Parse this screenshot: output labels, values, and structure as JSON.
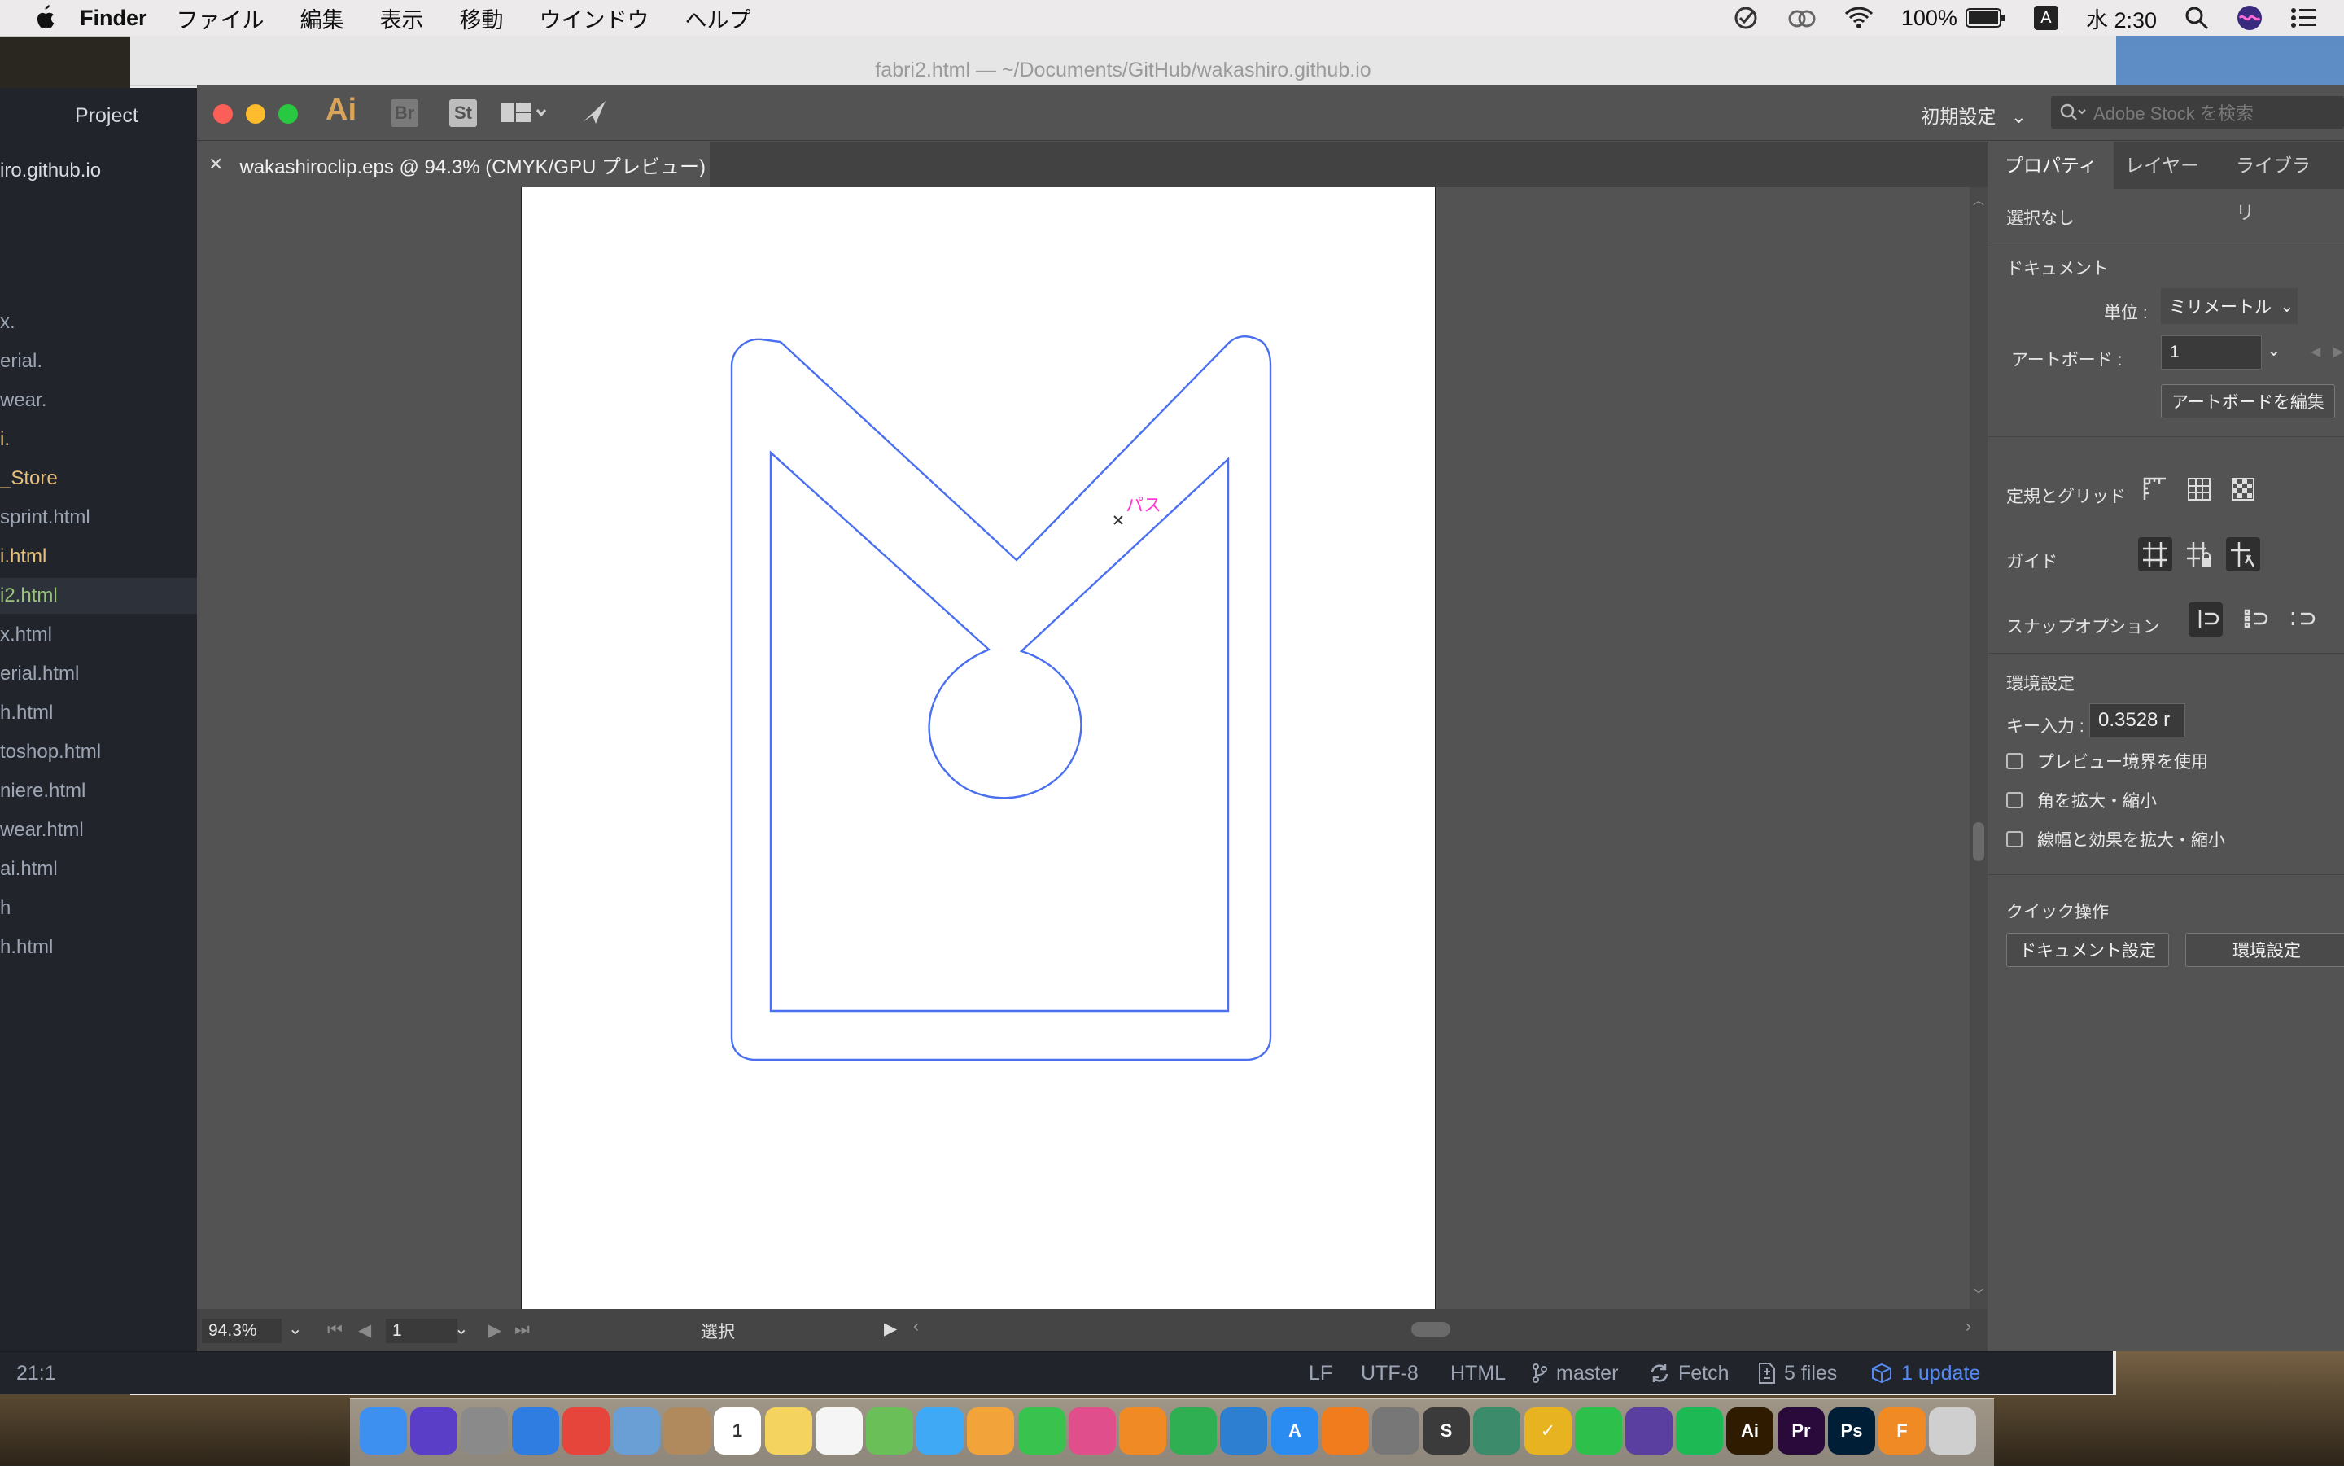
{
  "menubar": {
    "app_name": "Finder",
    "items": [
      "ファイル",
      "編集",
      "表示",
      "移動",
      "ウインドウ",
      "ヘルプ"
    ],
    "battery": "100%",
    "input_mode": "A",
    "clock": "水 2:30"
  },
  "background_window": {
    "title": "fabri2.html — ~/Documents/GitHub/wakashiro.github.io"
  },
  "atom_sidebar": {
    "header": "Project",
    "root": "iro.github.io",
    "items": [
      {
        "label": "x.",
        "color": "#9da5b4"
      },
      {
        "label": "erial.",
        "color": "#9da5b4"
      },
      {
        "label": "wear.",
        "color": "#9da5b4"
      },
      {
        "label": "i.",
        "color": "#e5c07b"
      },
      {
        "label": "_Store",
        "color": "#e5c07b"
      },
      {
        "label": "sprint.html",
        "color": "#9da5b4"
      },
      {
        "label": "i.html",
        "color": "#e5c07b"
      },
      {
        "label": "i2.html",
        "color": "#98c379"
      },
      {
        "label": "x.html",
        "color": "#9da5b4"
      },
      {
        "label": "erial.html",
        "color": "#9da5b4"
      },
      {
        "label": "h.html",
        "color": "#9da5b4"
      },
      {
        "label": "toshop.html",
        "color": "#9da5b4"
      },
      {
        "label": "niere.html",
        "color": "#9da5b4"
      },
      {
        "label": "wear.html",
        "color": "#9da5b4"
      },
      {
        "label": "ai.html",
        "color": "#9da5b4"
      },
      {
        "label": "h",
        "color": "#9da5b4"
      },
      {
        "label": "h.html",
        "color": "#9da5b4"
      }
    ]
  },
  "illustrator": {
    "logo": "Ai",
    "bridge": "Br",
    "stock": "St",
    "workspace": "初期設定",
    "stock_search_placeholder": "Adobe Stock を検索",
    "doc_tab": "wakashiroclip.eps @ 94.3% (CMYK/GPU プレビュー)",
    "path_label": "パス",
    "status": {
      "zoom": "94.3%",
      "artboard": "1",
      "tool": "選択"
    },
    "properties": {
      "tabs": [
        "プロパティ",
        "レイヤー",
        "ライブラリ"
      ],
      "selection": "選択なし",
      "document_heading": "ドキュメント",
      "unit_label": "単位 :",
      "unit_value": "ミリメートル",
      "artboard_label": "アートボード :",
      "artboard_value": "1",
      "edit_artboard": "アートボードを編集",
      "rulers_grid": "定規とグリッド",
      "guides": "ガイド",
      "snap_options": "スナップオプション",
      "preferences_heading": "環境設定",
      "key_input_label": "キー入力 :",
      "key_input_value": "0.3528 r",
      "checkboxes": [
        "プレビュー境界を使用",
        "角を拡大・縮小",
        "線幅と効果を拡大・縮小"
      ],
      "quick_actions": "クイック操作",
      "doc_setup_button": "ドキュメント設定",
      "prefs_button": "環境設定"
    }
  },
  "atom_status": {
    "cursor": "21:1",
    "line_ending": "LF",
    "encoding": "UTF-8",
    "grammar": "HTML",
    "branch": "master",
    "fetch": "Fetch",
    "files": "5 files",
    "update": "1 update"
  },
  "dock": {
    "apps": [
      {
        "name": "Finder",
        "color": "#3d8ff0",
        "glyph": ""
      },
      {
        "name": "Siri",
        "color": "#5a3ec8",
        "glyph": ""
      },
      {
        "name": "Launchpad",
        "color": "#8a8a8a",
        "glyph": ""
      },
      {
        "name": "Safari",
        "color": "#2f7de1",
        "glyph": ""
      },
      {
        "name": "Chrome",
        "color": "#e6453c",
        "glyph": ""
      },
      {
        "name": "Preview",
        "color": "#6a9fd6",
        "glyph": ""
      },
      {
        "name": "Contacts",
        "color": "#b08a5c",
        "glyph": ""
      },
      {
        "name": "Calendar",
        "color": "#ffffff",
        "glyph": "1"
      },
      {
        "name": "Notes",
        "color": "#f4d35e",
        "glyph": ""
      },
      {
        "name": "Reminders",
        "color": "#f5f5f5",
        "glyph": ""
      },
      {
        "name": "Maps",
        "color": "#6bbf59",
        "glyph": ""
      },
      {
        "name": "Messages",
        "color": "#3fa9f5",
        "glyph": ""
      },
      {
        "name": "Photos",
        "color": "#f2a33a",
        "glyph": ""
      },
      {
        "name": "FaceTime",
        "color": "#3ac24f",
        "glyph": ""
      },
      {
        "name": "iTunes",
        "color": "#e04f8c",
        "glyph": ""
      },
      {
        "name": "Pages",
        "color": "#f08a24",
        "glyph": ""
      },
      {
        "name": "Numbers",
        "color": "#2fae52",
        "glyph": ""
      },
      {
        "name": "Keynote",
        "color": "#2d7fd1",
        "glyph": ""
      },
      {
        "name": "App Store",
        "color": "#2a8cf0",
        "glyph": "A"
      },
      {
        "name": "Books",
        "color": "#f07c1e",
        "glyph": ""
      },
      {
        "name": "System Preferences",
        "color": "#777777",
        "glyph": ""
      },
      {
        "name": "Sublime",
        "color": "#3b3b3b",
        "glyph": "S"
      },
      {
        "name": "Atom",
        "color": "#3c8b6a",
        "glyph": ""
      },
      {
        "name": "Wunderlist",
        "color": "#e8b320",
        "glyph": "✓"
      },
      {
        "name": "LINE",
        "color": "#2dc04a",
        "glyph": ""
      },
      {
        "name": "GitHub",
        "color": "#5a3fa0",
        "glyph": ""
      },
      {
        "name": "Spotify",
        "color": "#1db954",
        "glyph": ""
      },
      {
        "name": "Illustrator",
        "color": "#2e1b00",
        "glyph": "Ai"
      },
      {
        "name": "Premiere",
        "color": "#2a0a3a",
        "glyph": "Pr"
      },
      {
        "name": "Photoshop",
        "color": "#001e36",
        "glyph": "Ps"
      },
      {
        "name": "Fusion 360",
        "color": "#f08a24",
        "glyph": "F"
      },
      {
        "name": "Trash",
        "color": "#cfcfcf",
        "glyph": ""
      }
    ]
  }
}
